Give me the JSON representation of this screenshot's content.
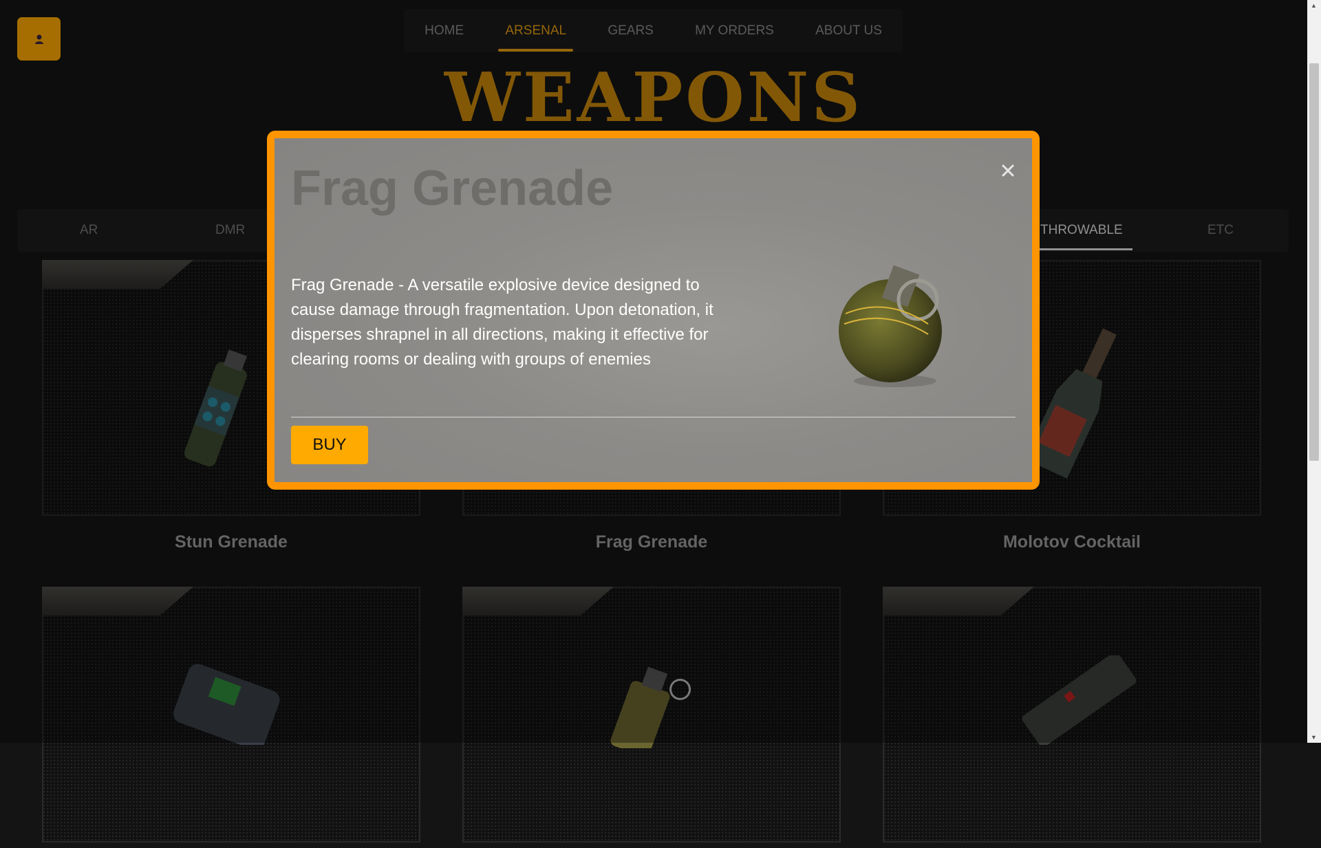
{
  "nav": {
    "items": [
      {
        "label": "HOME"
      },
      {
        "label": "ARSENAL"
      },
      {
        "label": "GEARS"
      },
      {
        "label": "MY ORDERS"
      },
      {
        "label": "ABOUT US"
      }
    ],
    "active": "ARSENAL"
  },
  "page": {
    "heading": "WEAPONS"
  },
  "categories": {
    "items": [
      {
        "label": "AR"
      },
      {
        "label": "DMR"
      },
      {
        "label": "THROWABLE"
      },
      {
        "label": "ETC"
      }
    ],
    "active": "THROWABLE"
  },
  "products": [
    {
      "name": "Stun Grenade"
    },
    {
      "name": "Frag Grenade"
    },
    {
      "name": "Molotov Cocktail"
    }
  ],
  "modal": {
    "title": "Frag Grenade",
    "description": "Frag Grenade - A versatile explosive device designed to cause damage through fragmentation. Upon detonation, it disperses shrapnel in all directions, making it effective for clearing rooms or dealing with groups of enemies",
    "buy_label": "BUY",
    "close_icon": "close-icon"
  },
  "colors": {
    "accent": "#ffaa00",
    "modal_border": "#ff9500",
    "heading": "#c8870c",
    "nav_active": "#e79e12"
  }
}
